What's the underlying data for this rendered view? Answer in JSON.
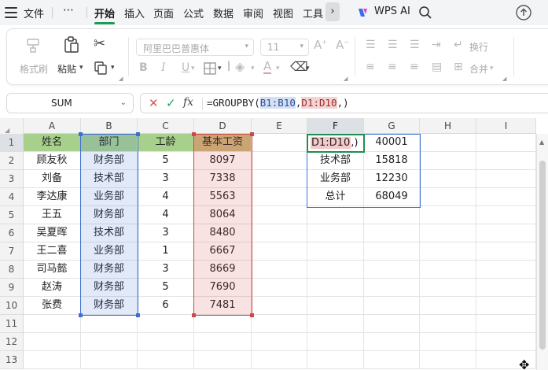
{
  "menubar": {
    "items": [
      "文件",
      "开始",
      "插入",
      "页面",
      "公式",
      "数据",
      "审阅",
      "视图",
      "工具"
    ],
    "more": "⋯",
    "active": "开始",
    "wps_ai": "WPS AI"
  },
  "toolbar": {
    "format_painter": "格式刷",
    "paste": "粘贴",
    "font_name": "阿里巴巴普惠体",
    "font_size": "11",
    "wrap": "换行",
    "merge": "合并"
  },
  "formula_bar": {
    "name_box": "SUM",
    "formula_prefix": "=GROUPBY(",
    "ref1": "B1:B10",
    "comma1": ",",
    "ref2": "D1:D10",
    "formula_suffix": ",)"
  },
  "grid": {
    "columns": [
      "A",
      "B",
      "C",
      "D",
      "E",
      "F",
      "G",
      "H",
      "I"
    ],
    "rows": [
      "1",
      "2",
      "3",
      "4",
      "5",
      "6",
      "7",
      "8",
      "9",
      "10",
      "11",
      "12",
      "13"
    ],
    "headers": [
      "姓名",
      "部门",
      "工龄",
      "基本工资"
    ],
    "data": [
      [
        "顾友秋",
        "财务部",
        "5",
        "8097"
      ],
      [
        "刘备",
        "技术部",
        "3",
        "7338"
      ],
      [
        "李达康",
        "业务部",
        "4",
        "5563"
      ],
      [
        "王五",
        "财务部",
        "4",
        "8064"
      ],
      [
        "吴夏晖",
        "技术部",
        "3",
        "8480"
      ],
      [
        "王二喜",
        "业务部",
        "1",
        "6667"
      ],
      [
        "司马懿",
        "财务部",
        "3",
        "8669"
      ],
      [
        "赵涛",
        "财务部",
        "5",
        "7690"
      ],
      [
        "张费",
        "财务部",
        "6",
        "7481"
      ]
    ],
    "editing_cell": {
      "ref": "D1:D10",
      "tail": ",)"
    },
    "result": [
      [
        "",
        "40001"
      ],
      [
        "技术部",
        "15818"
      ],
      [
        "业务部",
        "12230"
      ],
      [
        "总计",
        "68049"
      ]
    ]
  }
}
